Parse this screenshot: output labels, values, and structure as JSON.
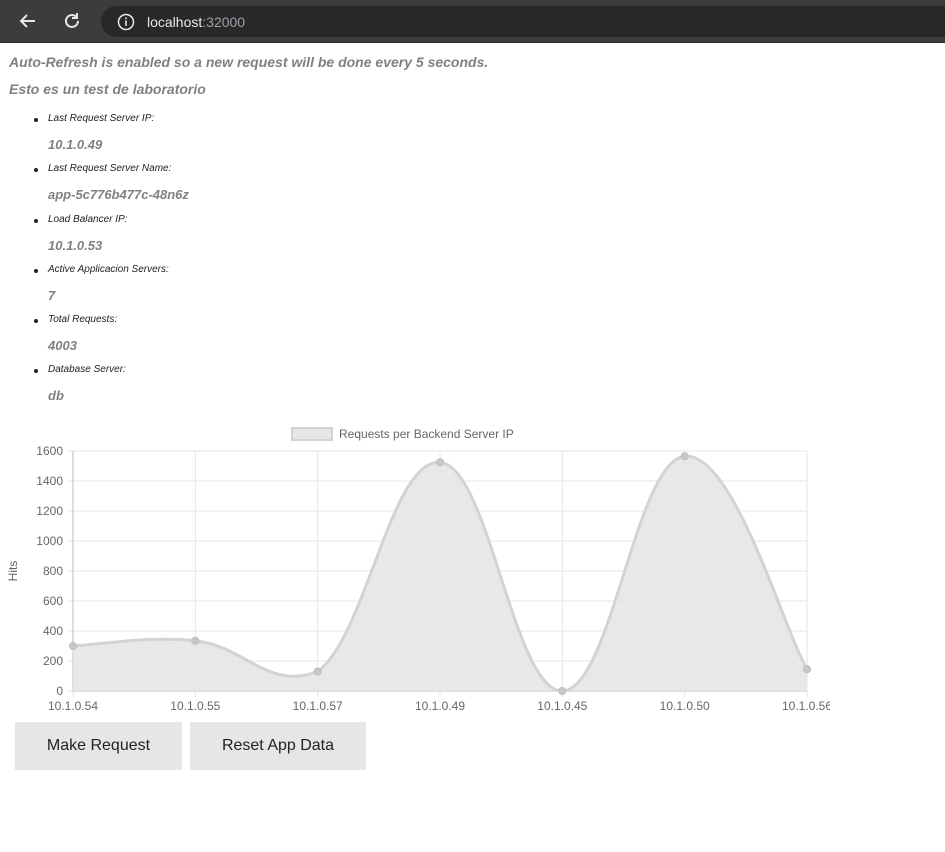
{
  "browser": {
    "url_host": "localhost",
    "url_port": ":32000"
  },
  "page": {
    "auto_refresh_message": "Auto-Refresh is enabled so a new request will be done every 5 seconds.",
    "subtitle": "Esto es un test de laboratorio",
    "items": [
      {
        "label": "Last Request Server IP:",
        "value": "10.1.0.49"
      },
      {
        "label": "Last Request Server Name:",
        "value": "app-5c776b477c-48n6z"
      },
      {
        "label": "Load Balancer IP:",
        "value": "10.1.0.53"
      },
      {
        "label": "Active Applicacion Servers:",
        "value": "7"
      },
      {
        "label": "Total Requests:",
        "value": "4003"
      },
      {
        "label": "Database Server:",
        "value": "db"
      }
    ],
    "buttons": {
      "make_request": "Make Request",
      "reset_app_data": "Reset App Data"
    }
  },
  "chart_data": {
    "type": "area",
    "categories": [
      "10.1.0.54",
      "10.1.0.55",
      "10.1.0.57",
      "10.1.0.49",
      "10.1.0.45",
      "10.1.0.50",
      "10.1.0.56"
    ],
    "series": [
      {
        "name": "Requests per Backend Server IP",
        "values": [
          300,
          335,
          130,
          1525,
          0,
          1565,
          145
        ]
      }
    ],
    "xlabel": "",
    "ylabel": "Hits",
    "ylim": [
      0,
      1600
    ],
    "yticks": [
      0,
      200,
      400,
      600,
      800,
      1000,
      1200,
      1400,
      1600
    ],
    "grid": true,
    "legend_position": "top",
    "colors": {
      "fill": "#e6e6e6",
      "line": "#d3d3d3",
      "point": "#c8c8c8"
    }
  }
}
